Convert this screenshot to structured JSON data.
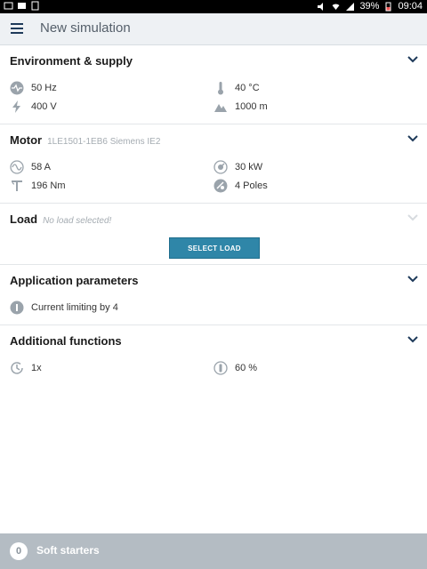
{
  "statusbar": {
    "battery": "39%",
    "time": "09:04"
  },
  "appbar": {
    "title": "New simulation"
  },
  "environment": {
    "title": "Environment & supply",
    "frequency": "50 Hz",
    "temperature": "40 °C",
    "voltage": "400 V",
    "altitude": "1000 m"
  },
  "motor": {
    "title": "Motor",
    "model": "1LE1501-1EB6 Siemens IE2",
    "current": "58 A",
    "power": "30 kW",
    "torque": "196 Nm",
    "poles": "4 Poles"
  },
  "load": {
    "title": "Load",
    "subtitle": "No load selected!",
    "button": "SELECT LOAD"
  },
  "application": {
    "title": "Application parameters",
    "current_limiting": "Current limiting by 4"
  },
  "additional": {
    "title": "Additional functions",
    "starts": "1x",
    "duty": "60 %"
  },
  "footer": {
    "count": "0",
    "label": "Soft starters"
  },
  "colors": {
    "accent": "#2f86a8",
    "footer": "#b4bcc3",
    "icon": "#9aa3ab"
  }
}
